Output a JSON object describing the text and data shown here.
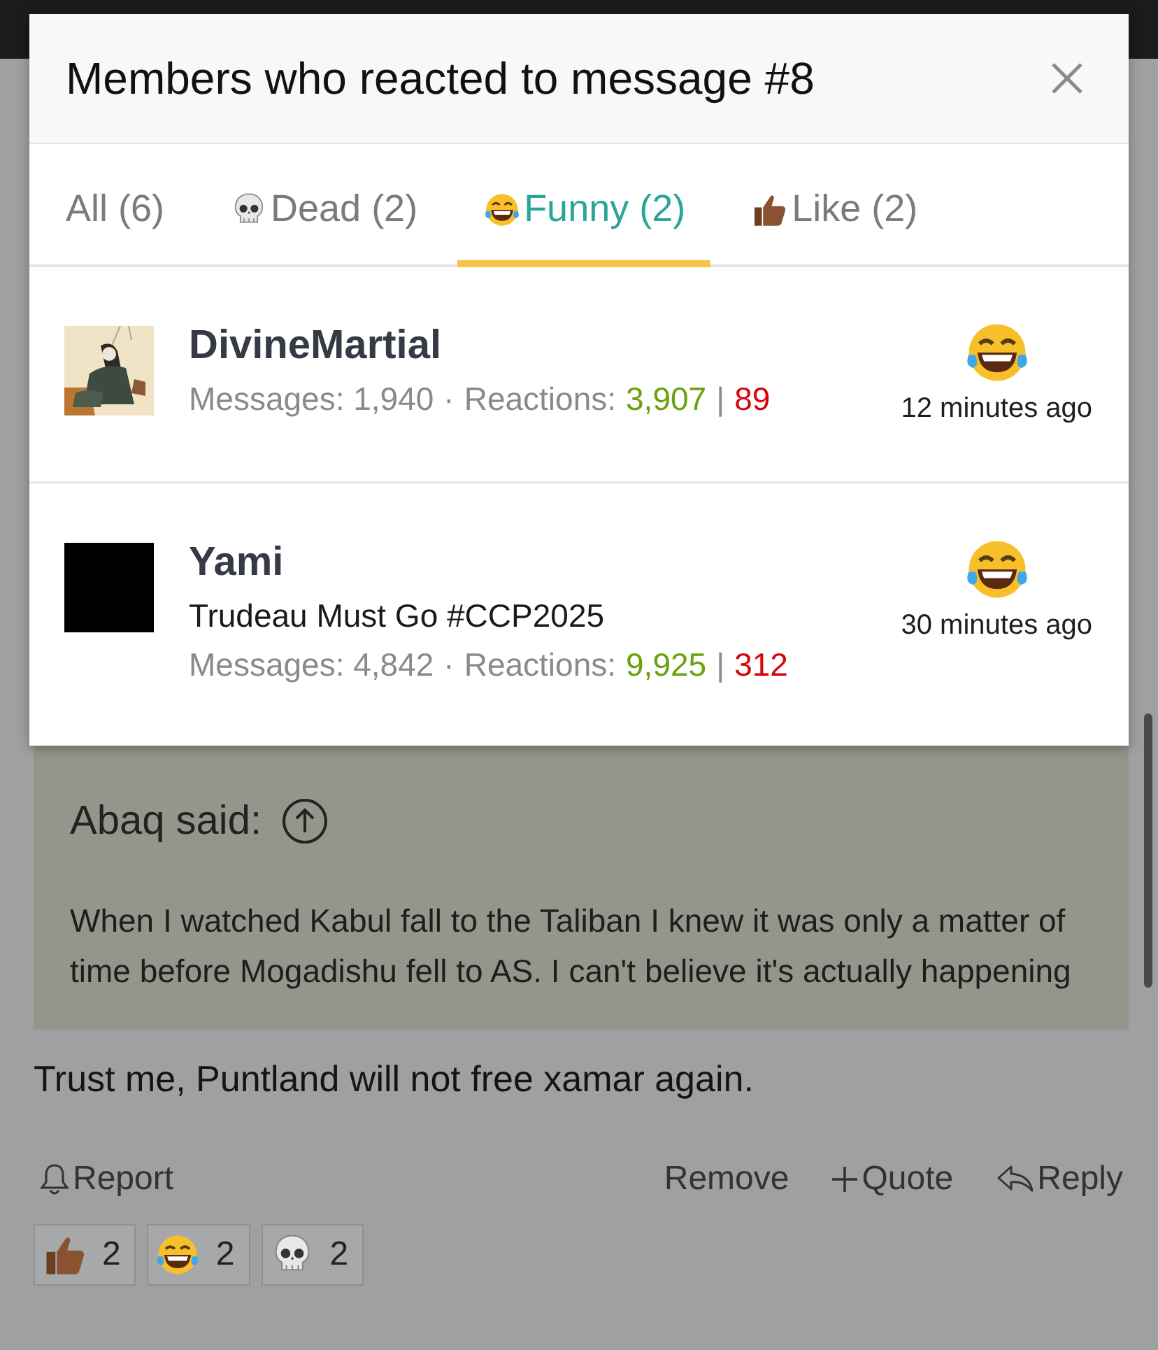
{
  "dialog": {
    "title": "Members who reacted to message #8",
    "tabs": [
      {
        "label": "All (6)",
        "kind": "all",
        "selected": false
      },
      {
        "label": "Dead (2)",
        "kind": "dead",
        "selected": false
      },
      {
        "label": "Funny (2)",
        "kind": "funny",
        "selected": true
      },
      {
        "label": "Like (2)",
        "kind": "like",
        "selected": false
      }
    ],
    "members": [
      {
        "name": "DivineMartial",
        "messages": "Messages: 1,940",
        "dot": "·",
        "reactions": "Reactions:",
        "positive": "3,907",
        "bar": "|",
        "negative": "89",
        "time": "12 minutes ago"
      },
      {
        "name": "Yami",
        "avatar": {
          "kind": "plain"
        },
        "signature": "Trudeau Must Go #CCP2025",
        "messages": "Messages: 4,842",
        "dot": "·",
        "reactions": "Reactions:",
        "positive": "9,925",
        "bar": "|",
        "negative": "312",
        "time": "30 minutes ago"
      }
    ]
  },
  "post": {
    "quote_author": "Abaq said:",
    "quote_text": "When I watched Kabul fall to the Taliban I knew it was only a matter of time before Mogadishu fell to AS. I can't believe it's actually happening",
    "message": "Trust me, Puntland will not free xamar again.",
    "actions": [
      {
        "label": "Report",
        "kind": "report"
      },
      {
        "label": "Remove",
        "kind": "remove"
      },
      {
        "label": "Quote",
        "kind": "quote"
      },
      {
        "label": "Reply",
        "kind": "reply"
      }
    ],
    "reactions": [
      {
        "kind": "like",
        "count": "2"
      },
      {
        "kind": "funny",
        "count": "2"
      },
      {
        "kind": "dead",
        "count": "2"
      }
    ]
  }
}
